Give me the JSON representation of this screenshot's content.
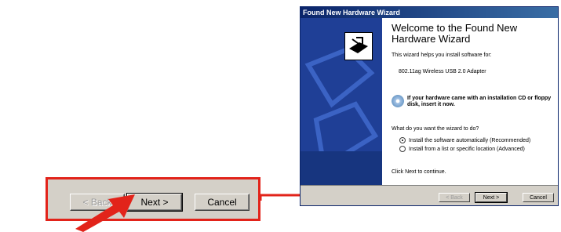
{
  "zoom": {
    "back_label": "< Back",
    "next_label": "Next >",
    "cancel_label": "Cancel"
  },
  "wizard": {
    "title": "Found New Hardware Wizard",
    "heading": "Welcome to the Found New Hardware Wizard",
    "intro": "This wizard helps you install software for:",
    "device": "802.11ag Wireless USB 2.0 Adapter",
    "cd_hint": "If your hardware came with an installation CD or floppy disk, insert it now.",
    "question": "What do you want the wizard to do?",
    "options": [
      {
        "label": "Install the software automatically (Recommended)",
        "selected": true
      },
      {
        "label": "Install from a list or specific location (Advanced)",
        "selected": false
      }
    ],
    "continue_text": "Click Next to continue.",
    "buttons": {
      "back": "< Back",
      "next": "Next >",
      "cancel": "Cancel"
    }
  },
  "colors": {
    "highlight": "#e2231a",
    "title_bar": "#0a246a",
    "side_panel": "#1f3f96"
  }
}
